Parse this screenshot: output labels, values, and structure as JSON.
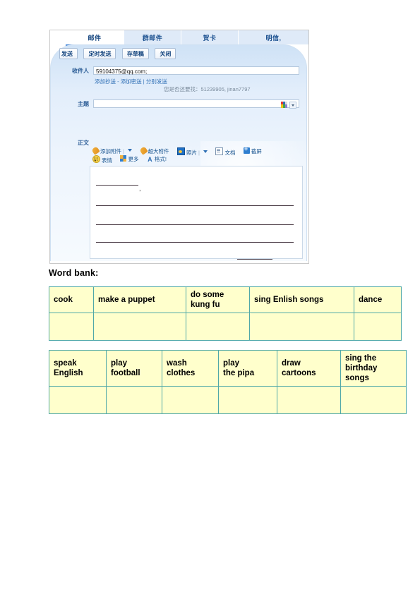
{
  "mail_client": {
    "tabs": [
      {
        "label": "邮件",
        "active": true,
        "name": "tab-compose-mail"
      },
      {
        "label": "群邮件",
        "active": false,
        "name": "tab-group-mail"
      },
      {
        "label": "贺卡",
        "active": false,
        "name": "tab-greeting-card"
      },
      {
        "label": "明信,",
        "active": false,
        "name": "tab-postcard"
      }
    ],
    "buttons": [
      {
        "label": "发送",
        "name": "send-button"
      },
      {
        "label": "定时发送",
        "name": "scheduled-send-button"
      },
      {
        "label": "存草稿",
        "name": "save-draft-button"
      },
      {
        "label": "关闭",
        "name": "close-button"
      }
    ],
    "fields": {
      "to_label": "收件人",
      "to_value": "59104375@qq.com;",
      "subject_label": "主题",
      "subject_value": "",
      "body_label": "正文"
    },
    "sublinks": {
      "add_cc": "添加抄送",
      "separator1": "-",
      "add_bcc": "添加密送",
      "separator2": "|",
      "send_separately": "分别发送"
    },
    "suggestion": "您是否还要找：51239905, jinan7797",
    "toolbar": {
      "row1": [
        {
          "label": "添加附件",
          "icon": "paperclip-icon",
          "has_caret": true
        },
        {
          "label": "超大附件",
          "icon": "paperclip-icon",
          "has_caret": false
        },
        {
          "label": "照片",
          "icon": "photo-icon",
          "has_caret": true
        },
        {
          "label": "文档",
          "icon": "document-icon",
          "has_caret": false
        },
        {
          "label": "截屏",
          "icon": "screenshot-icon",
          "has_caret": false
        }
      ],
      "row2": [
        {
          "label": "表情",
          "icon": "smiley-icon",
          "has_caret": false
        },
        {
          "label": "更多",
          "icon": "more-grid-icon",
          "has_caret": false
        },
        {
          "label": "格式!",
          "icon": "format-text-icon",
          "has_caret": false
        }
      ]
    },
    "stationery_icon": "stationery-grid-icon",
    "colors": {
      "panel_blue": "#cfe2f6",
      "tab_blue": "#dfeaf8",
      "link_blue": "#2f6fb5",
      "label_blue": "#2c5d96"
    }
  },
  "worksheet": {
    "word_bank_title": "Word bank:",
    "table1": {
      "row_words": [
        "cook",
        "make a puppet",
        "do some kung fu",
        "sing Enlish songs",
        "dance"
      ],
      "blank_row": [
        "",
        "",
        "",
        "",
        ""
      ]
    },
    "table2": {
      "row_words": [
        "speak English",
        "play football",
        "wash clothes",
        "play\nthe pipa",
        "draw cartoons",
        "sing the birthday songs"
      ],
      "blank_row": [
        "",
        "",
        "",
        "",
        "",
        ""
      ]
    },
    "colors": {
      "cell_fill": "#ffffcc",
      "cell_border": "#4fa8a8",
      "text": "#000000"
    }
  }
}
